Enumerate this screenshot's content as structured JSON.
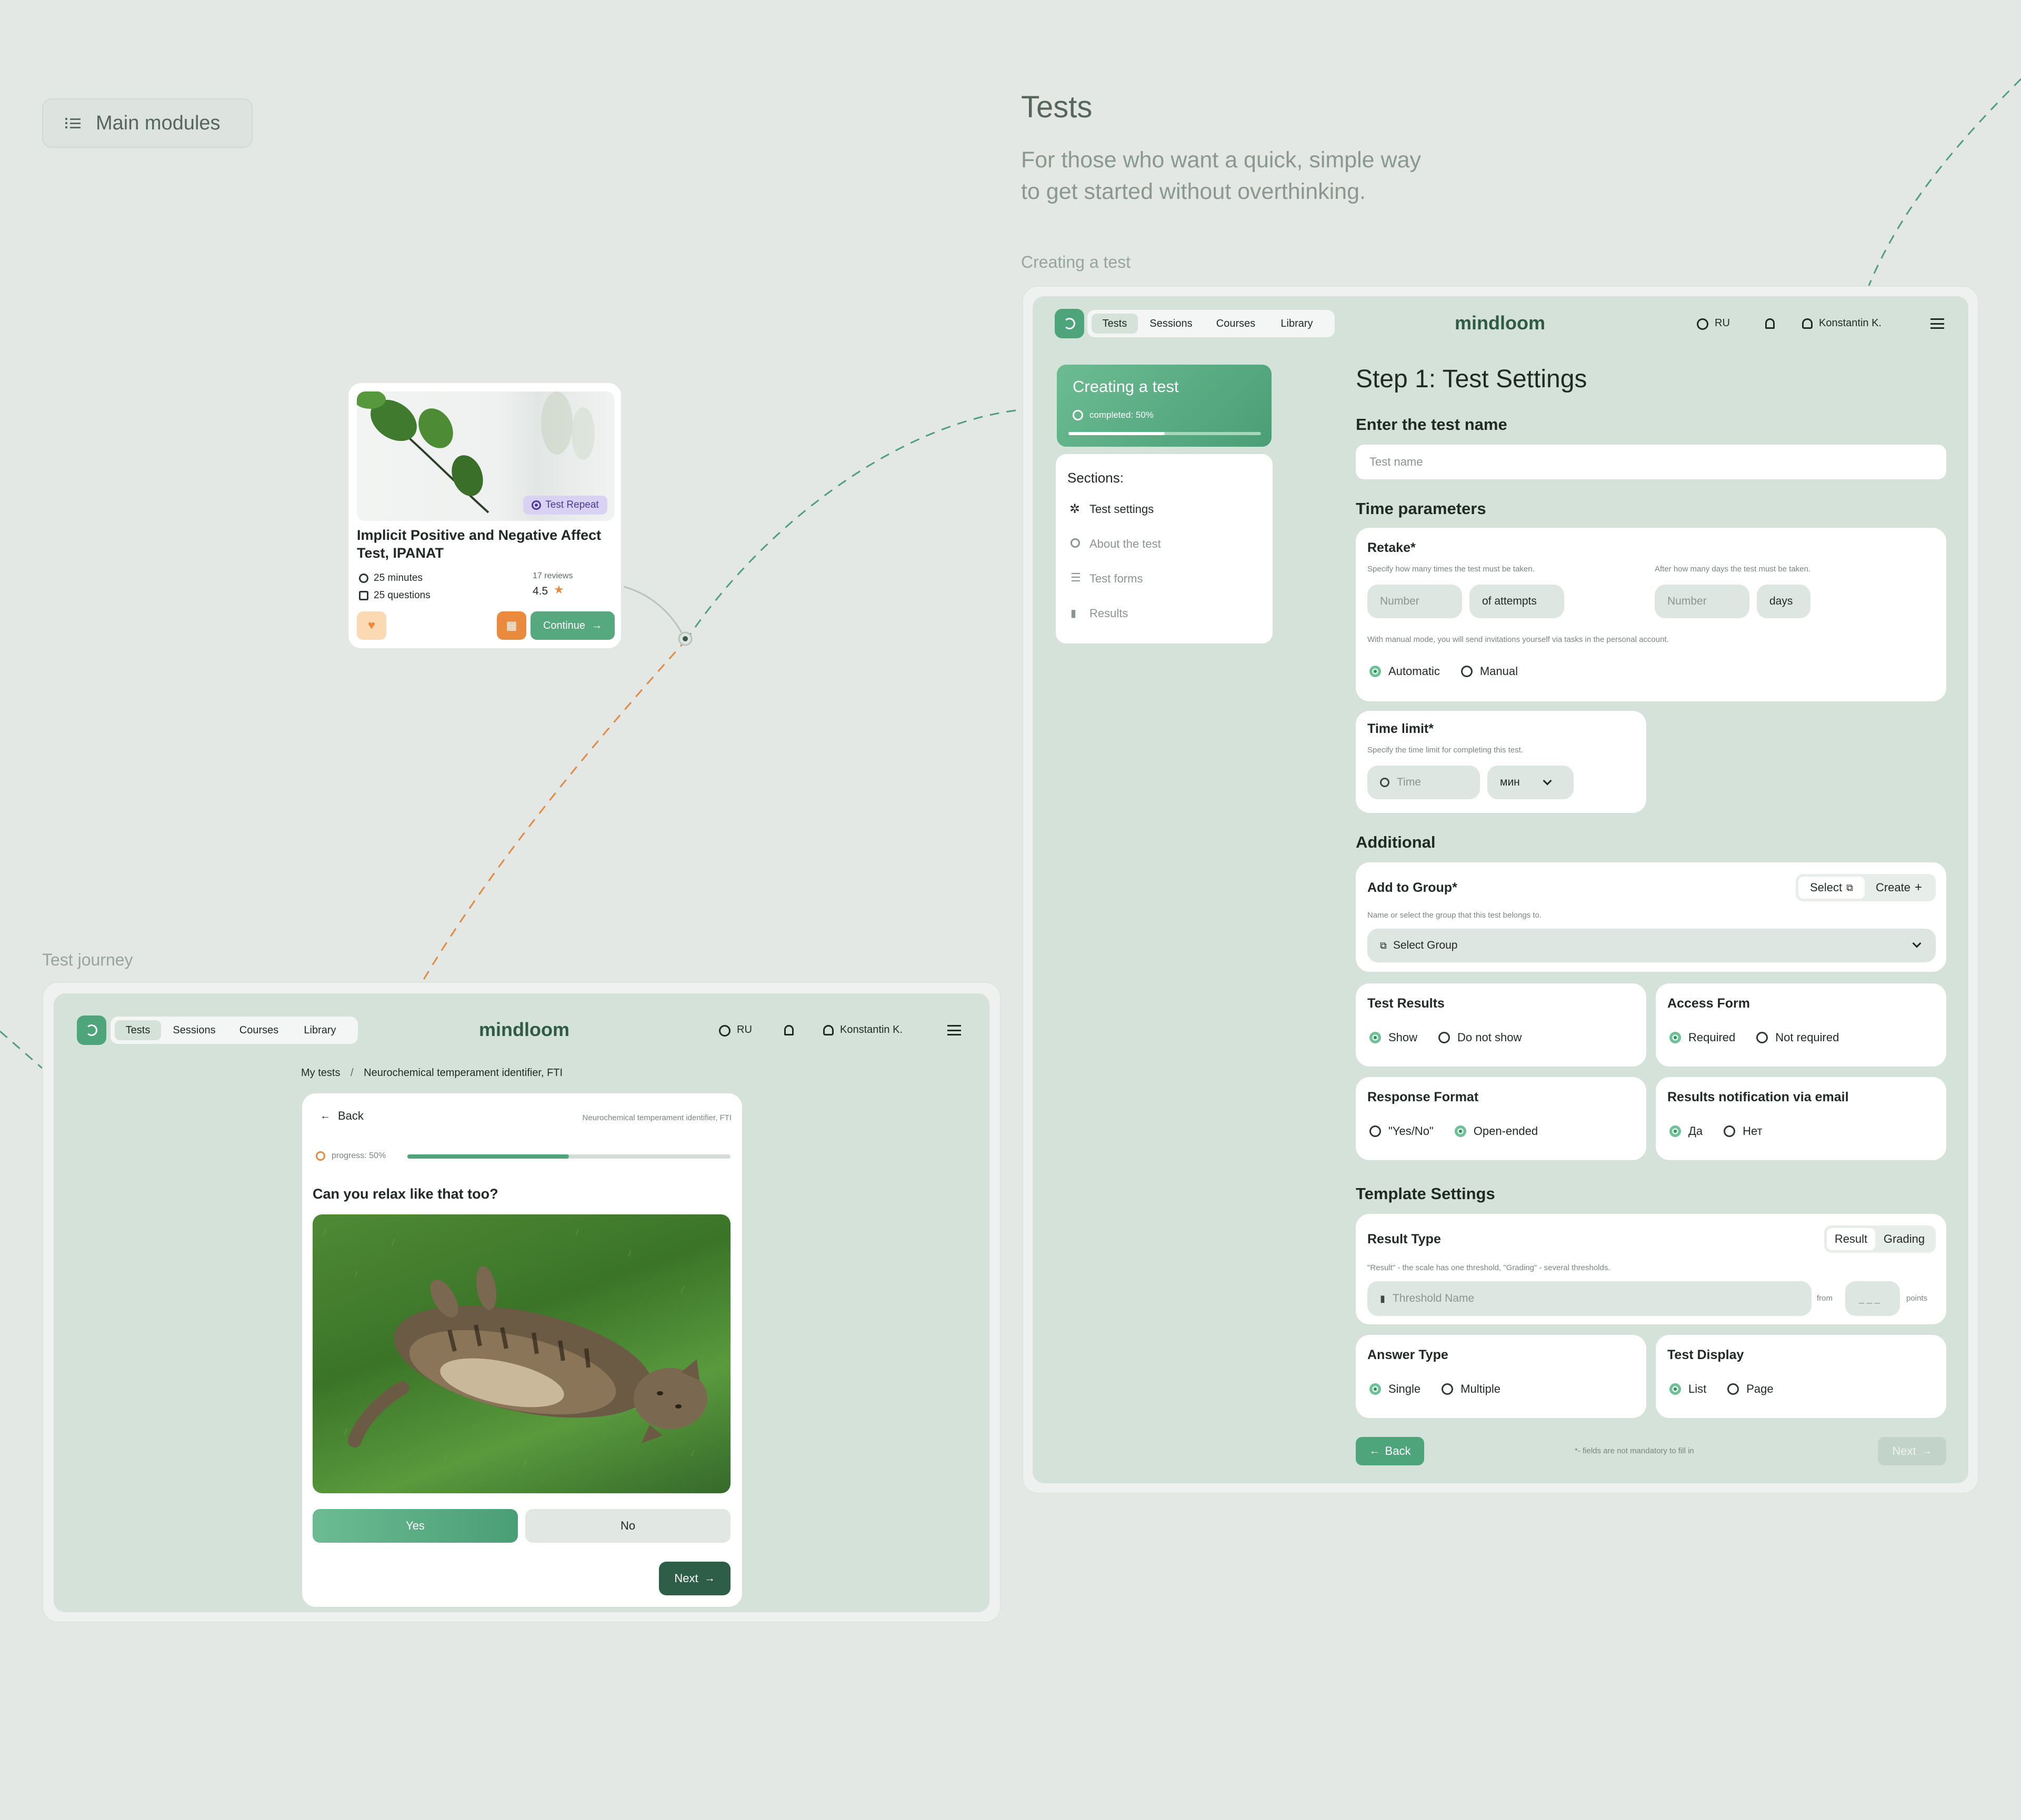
{
  "modules_chip": {
    "icon": "list-icon",
    "label": "Main modules"
  },
  "header": {
    "title": "Tests",
    "subtitle_line1": "For those who want a quick, simple way",
    "subtitle_line2": "to get started without overthinking."
  },
  "labels": {
    "creating": "Creating a test",
    "journey": "Test journey"
  },
  "nav": {
    "tabs": [
      "Tests",
      "Sessions",
      "Courses",
      "Library"
    ],
    "logo": "mindloom",
    "lang": "RU",
    "user": "Konstantin K."
  },
  "test_card": {
    "badge": "Test Repeat",
    "title_line1": "Implicit Positive and Negative Affect",
    "title_line2": "Test, IPANAT",
    "duration": "25 minutes",
    "questions": "25 questions",
    "reviews": "17 reviews",
    "rating": "4.5",
    "continue_label": "Continue"
  },
  "sidebar": {
    "progress_title": "Creating a test",
    "progress_text": "completed: 50%",
    "progress": 0.5,
    "sections_title": "Sections:",
    "items": [
      "Test settings",
      "About the test",
      "Test forms",
      "Results"
    ]
  },
  "form": {
    "step_title": "Step 1: Test Settings",
    "name_label": "Enter the test name",
    "name_placeholder": "Test name",
    "time_params": "Time parameters",
    "retake": {
      "title": "Retake*",
      "hint1": "Specify how many times the test must be taken.",
      "hint2": "After how many days the test must be taken.",
      "number1": "Number",
      "attempts": "of attempts",
      "number2": "Number",
      "days": "days",
      "manual_hint": "With manual mode, you will send invitations yourself via tasks in the personal account.",
      "opt_auto": "Automatic",
      "opt_manual": "Manual"
    },
    "time_limit": {
      "title": "Time limit*",
      "hint": "Specify the time limit for completing this test.",
      "time": "Time",
      "unit": "мин"
    },
    "additional": "Additional",
    "group": {
      "title": "Add to Group*",
      "select_btn": "Select",
      "create_btn": "Create",
      "hint": "Name or select the group that this test belongs to.",
      "dropdown": "Select Group"
    },
    "test_results": {
      "title": "Test Results",
      "opt1": "Show",
      "opt2": "Do not show"
    },
    "access_form": {
      "title": "Access Form",
      "opt1": "Required",
      "opt2": "Not required"
    },
    "response_format": {
      "title": "Response Format",
      "opt1": "\"Yes/No\"",
      "opt2": "Open-ended"
    },
    "notification": {
      "title": "Results notification via email",
      "opt1": "Да",
      "opt2": "Нет"
    },
    "template": "Template Settings",
    "result_type": {
      "title": "Result Type",
      "seg1": "Result",
      "seg2": "Grading",
      "hint": "\"Result\" - the scale has one threshold, \"Grading\" - several thresholds.",
      "threshold": "Threshold Name",
      "from": "from",
      "dash": "_ _ _",
      "points": "points"
    },
    "answer_type": {
      "title": "Answer Type",
      "opt1": "Single",
      "opt2": "Multiple"
    },
    "test_display": {
      "title": "Test Display",
      "opt1": "List",
      "opt2": "Page"
    },
    "back": "Back",
    "note": "*- fields are not mandatory to fill in",
    "next": "Next"
  },
  "journey": {
    "breadcrumb1": "My tests",
    "sep": "/",
    "breadcrumb2": "Neurochemical temperament identifier, FTI",
    "back": "Back",
    "test_name": "Neurochemical temperament identifier, FTI",
    "progress_text": "progress: 50%",
    "progress": 0.5,
    "question": "Can you relax like that too?",
    "yes": "Yes",
    "no": "No",
    "next": "Next"
  },
  "colors": {
    "bg": "#e4e8e5",
    "panel": "#d4e2d9",
    "accent": "#4ea57c",
    "dark": "#2e5e48",
    "orange": "#e98a3e"
  }
}
